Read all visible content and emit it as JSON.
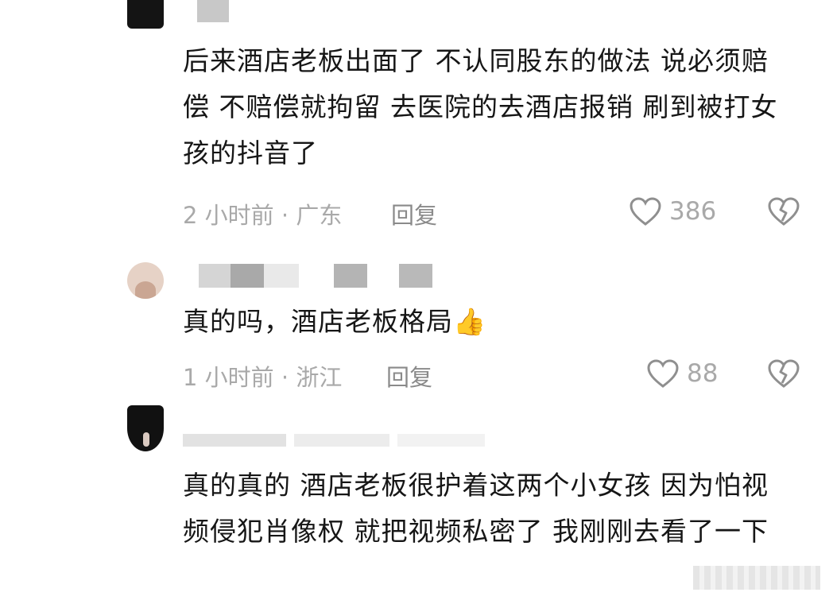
{
  "comments": [
    {
      "text": "后来酒店老板出面了 不认同股东的做法 说必须赔偿 不赔偿就拘留 去医院的去酒店报销 刷到被打女孩的抖音了",
      "time_location": "2 小时前 · 广东",
      "reply_label": "回复",
      "likes": "386",
      "avatar_color": "#141414"
    },
    {
      "text": "真的吗，酒店老板格局👍",
      "time_location": "1 小时前 · 浙江",
      "reply_label": "回复",
      "likes": "88",
      "avatar_color": "#e6d2c6"
    },
    {
      "text": "真的真的 酒店老板很护着这两个小女孩 因为怕视频侵犯肖像权 就把视频私密了 我刚刚去看了一下",
      "avatar_color": "#111111"
    }
  ],
  "icons": {
    "like": "heart-outline-icon",
    "dislike": "broken-heart-icon"
  },
  "colors": {
    "text": "#161616",
    "meta": "#a9a9a9",
    "icon": "#8f8f8f"
  }
}
